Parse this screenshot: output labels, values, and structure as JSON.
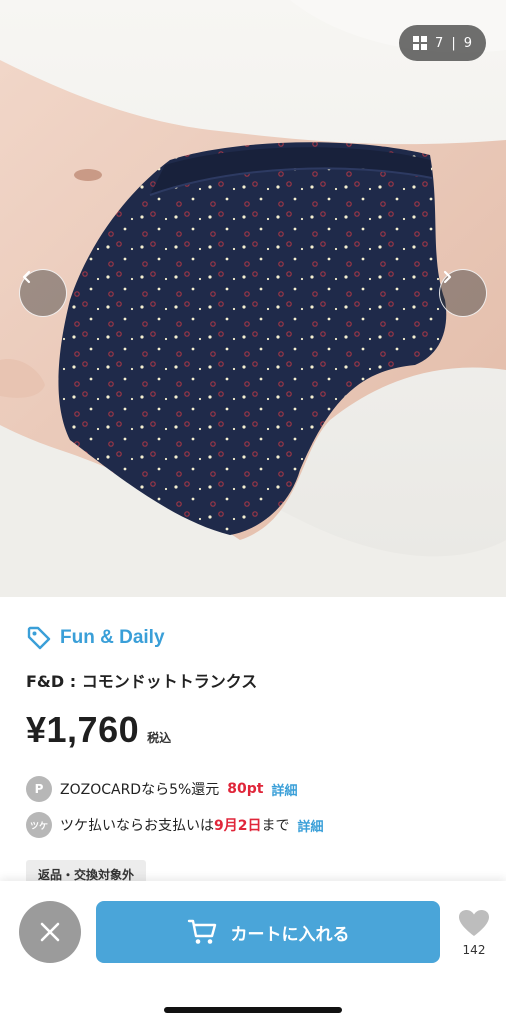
{
  "gallery": {
    "current": "7",
    "separator": "|",
    "total": "9",
    "grid_icon": "grid-icon",
    "prev_icon": "chevron-left-icon",
    "next_icon": "chevron-right-icon"
  },
  "product": {
    "brand": "Fun & Daily",
    "brand_icon": "tag-icon",
    "title": "F&D : コモンドットトランクス",
    "price": "¥1,760",
    "tax_label": "税込"
  },
  "zozocard": {
    "icon_label": "P",
    "text_before": "ZOZOCARDなら5%還元 ",
    "points": "80pt",
    "link": "詳細"
  },
  "tsuke": {
    "icon_label": "ツケ",
    "text_before": "ツケ払いならお支払いは",
    "date": "9月2日",
    "text_after": "まで",
    "link": "詳細"
  },
  "badge": "返品・交換対象外",
  "actions": {
    "cart_label": "カートに入れる",
    "favorite_count": "142"
  },
  "colors": {
    "accent": "#4aa5d9",
    "brand_blue": "#3a9fd8",
    "highlight_red": "#e0263a",
    "fabric_navy": "#1f2a4a"
  }
}
